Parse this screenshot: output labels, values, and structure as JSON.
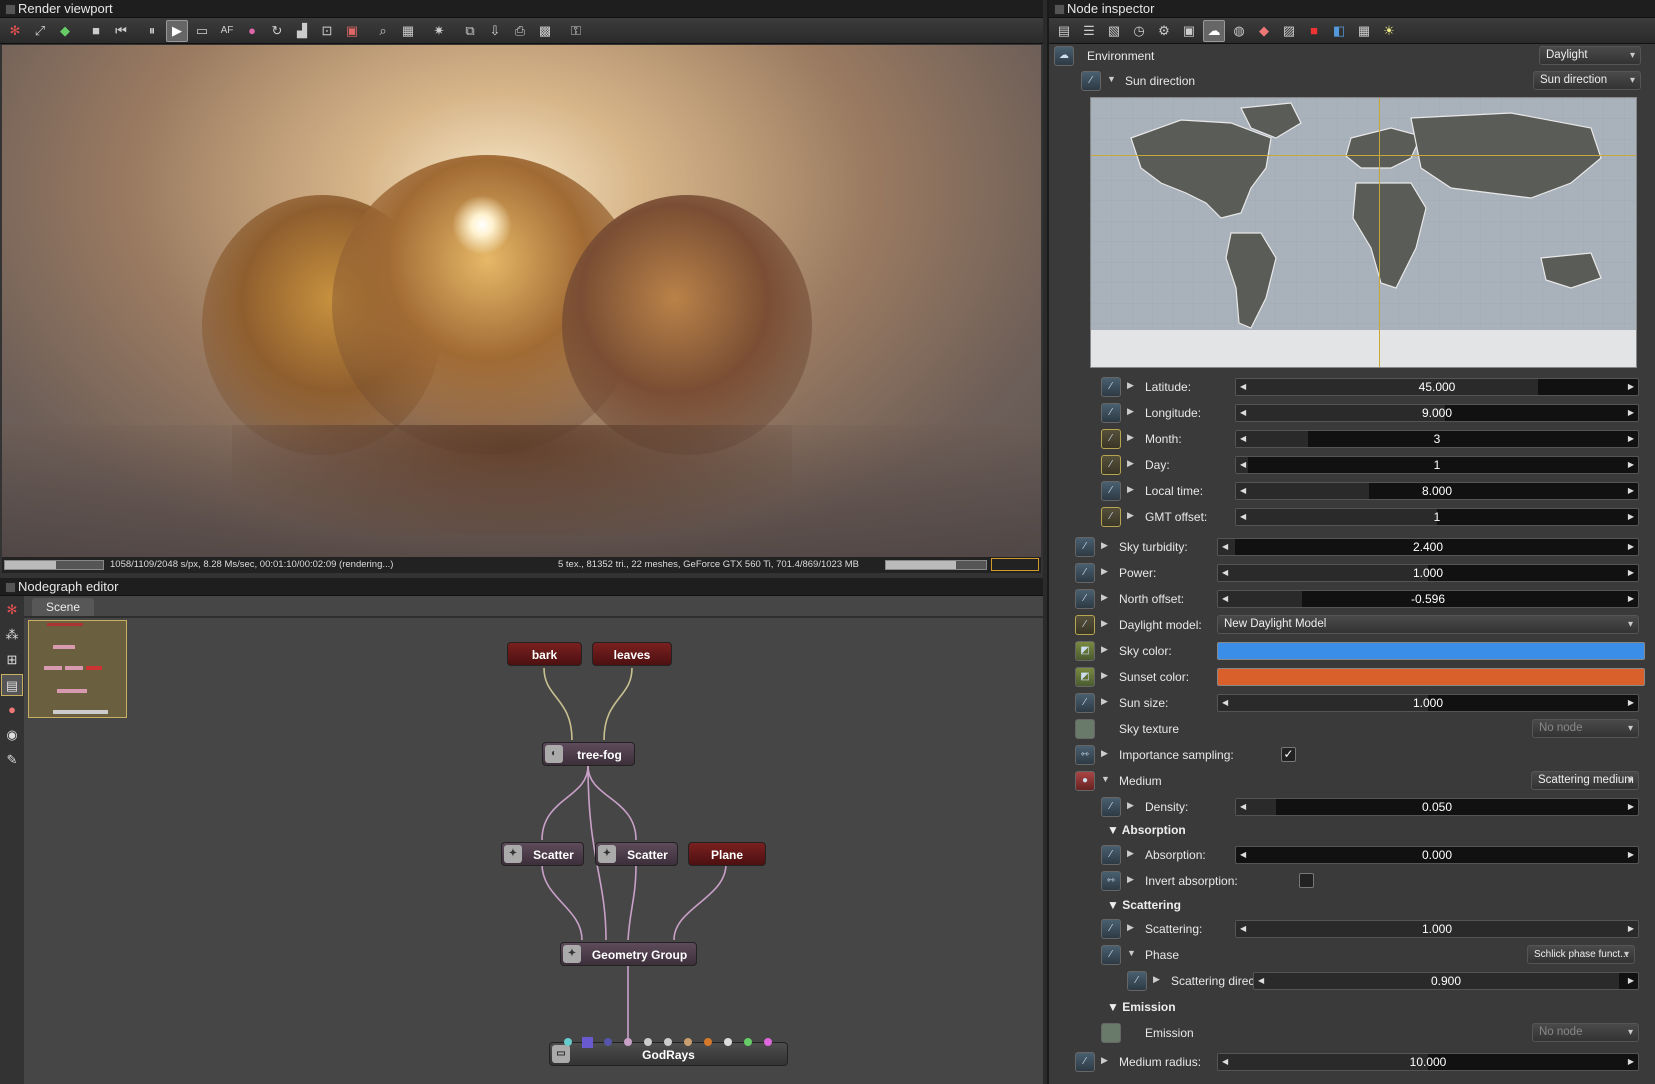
{
  "render_viewport": {
    "title": "Render viewport",
    "toolbar_icons": [
      "app-logo-icon",
      "fit-icon",
      "cube-color-icon",
      "stop-icon",
      "rewind-icon",
      "pause-icon",
      "play-icon",
      "monitor-icon",
      "af-icon",
      "color-wheel-icon",
      "refresh-icon",
      "histogram-icon",
      "region-icon",
      "crop-icon",
      "zoom-icon",
      "frame-icon",
      "sparkle-icon",
      "copy-icon",
      "export-icon",
      "save-icon",
      "checker-icon",
      "lock-icon"
    ],
    "status_left": "1058/1109/2048 s/px, 8.28 Ms/sec, 00:01:10/00:02:09 (rendering...)",
    "status_right": "5 tex., 81352 tri., 22 meshes, GeForce GTX 560 Ti, 701.4/869/1023 MB",
    "progress": 0.52
  },
  "nodegraph": {
    "title": "Nodegraph editor",
    "tab": "Scene",
    "nodes": {
      "bark": "bark",
      "leaves": "leaves",
      "tree_fog": "tree-fog",
      "scatter1": "Scatter",
      "scatter2": "Scatter",
      "plane": "Plane",
      "geometry_group": "Geometry Group",
      "godrays": "GodRays"
    }
  },
  "inspector": {
    "title": "Node inspector",
    "environment_label": "Environment",
    "environment_type": "Daylight",
    "sun_direction_label": "Sun direction",
    "sun_direction_value": "Sun direction",
    "rows": {
      "latitude": {
        "label": "Latitude:",
        "value": "45.000",
        "fill": 0.75
      },
      "longitude": {
        "label": "Longitude:",
        "value": "9.000",
        "fill": 0.52
      },
      "month": {
        "label": "Month:",
        "value": "3",
        "fill": 0.18
      },
      "day": {
        "label": "Day:",
        "value": "1",
        "fill": 0.03
      },
      "local_time": {
        "label": "Local time:",
        "value": "8.000",
        "fill": 0.33
      },
      "gmt_offset": {
        "label": "GMT offset:",
        "value": "1",
        "fill": 0.5
      },
      "sky_turbidity": {
        "label": "Sky turbidity:",
        "value": "2.400",
        "fill": 0.04
      },
      "power": {
        "label": "Power:",
        "value": "1.000",
        "fill": 0.5
      },
      "north_offset": {
        "label": "North offset:",
        "value": "-0.596",
        "fill": 0.2
      },
      "daylight_model": {
        "label": "Daylight model:",
        "value": "New Daylight Model"
      },
      "sky_color": {
        "label": "Sky color:",
        "color": "#3a8ee8"
      },
      "sunset_color": {
        "label": "Sunset color:",
        "color": "#d9602a"
      },
      "sun_size": {
        "label": "Sun size:",
        "value": "1.000",
        "fill": 0.5
      },
      "sky_texture": {
        "label": "Sky texture",
        "value": "No node"
      },
      "importance_sampling": {
        "label": "Importance sampling:",
        "checked": "✓"
      },
      "medium": {
        "label": "Medium",
        "value": "Scattering medium"
      },
      "density": {
        "label": "Density:",
        "value": "0.050",
        "fill": 0.1
      },
      "absorption_section": "Absorption",
      "absorption": {
        "label": "Absorption:",
        "value": "0.000",
        "fill": 0.0
      },
      "invert_absorption": {
        "label": "Invert absorption:"
      },
      "scattering_section": "Scattering",
      "scattering": {
        "label": "Scattering:",
        "value": "1.000",
        "fill": 1.0
      },
      "phase": {
        "label": "Phase",
        "value": "Schlick phase funct..."
      },
      "scattering_direction": {
        "label": "Scattering direction:",
        "value": "0.900",
        "fill": 0.95
      },
      "emission_section": "Emission",
      "emission": {
        "label": "Emission",
        "value": "No node"
      },
      "medium_radius": {
        "label": "Medium radius:",
        "value": "10.000",
        "fill": 0.5
      }
    }
  }
}
